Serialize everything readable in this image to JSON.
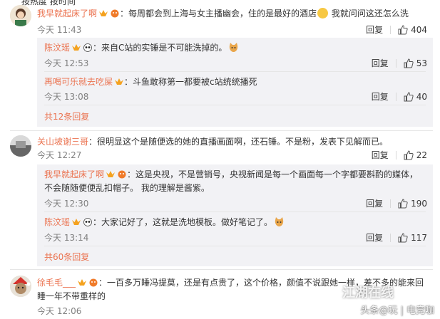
{
  "top_cut": "按热度   按时间",
  "comments": [
    {
      "name": "我早就起床了啊",
      "text": "：每周都会到上海与女主播幽会，住的是最好的酒店",
      "text2": " 我就问问这还怎么洗",
      "time": "今天 11:43",
      "reply_label": "回复",
      "likes": "404"
    },
    {
      "name": "关山坡谢三哥",
      "text": "：很明显这个是随便选的她的直播画面啊，还石锤。不是粉，发表下见解而已。",
      "time": "今天 12:27",
      "reply_label": "回复",
      "likes": "22"
    },
    {
      "name": "徐毛毛___",
      "text": "：一百多万睡冯提莫，还是有点贵了，这个价格，颜值不说跟她一样，差不多的能来回",
      "text_line2": "睡一年不带重样的",
      "time": "今天 12:06"
    }
  ],
  "replies_group1": [
    {
      "name": "陈汶瑶",
      "text": "：来自C站的实锤是不可能洗掉的。",
      "time": "今天 12:53",
      "reply_label": "回复",
      "likes": "53"
    },
    {
      "name": "再喝可乐就去吃屎",
      "text": "：斗鱼敢称第一都要被c站统统播死",
      "time": "今天 13:08",
      "reply_label": "回复",
      "likes": "40"
    }
  ],
  "more1": "共12条回复",
  "replies_group2": [
    {
      "name": "我早就起床了啊",
      "text": "：这是央视，不是营销号，央视新闻是每一个画面每一个字都要斟酌的媒体，",
      "text_line2": "不会随随便便乱扣帽子。   我的理解是酱紫。",
      "time": "今天 12:30",
      "reply_label": "回复",
      "likes": "190"
    },
    {
      "name": "陈汶瑶",
      "text": "：大家记好了，这就是洗地模板。做好笔记了。",
      "time": "今天 13:14",
      "reply_label": "回复",
      "likes": "117"
    }
  ],
  "more2": "共60条回复",
  "watermark": "头条@玩 | 电竞咖",
  "watermark_big": "江湖在线",
  "colors": {
    "name": "#eb7350",
    "reply_bg": "#f2f2f5",
    "divider": "#e6e6e6"
  }
}
